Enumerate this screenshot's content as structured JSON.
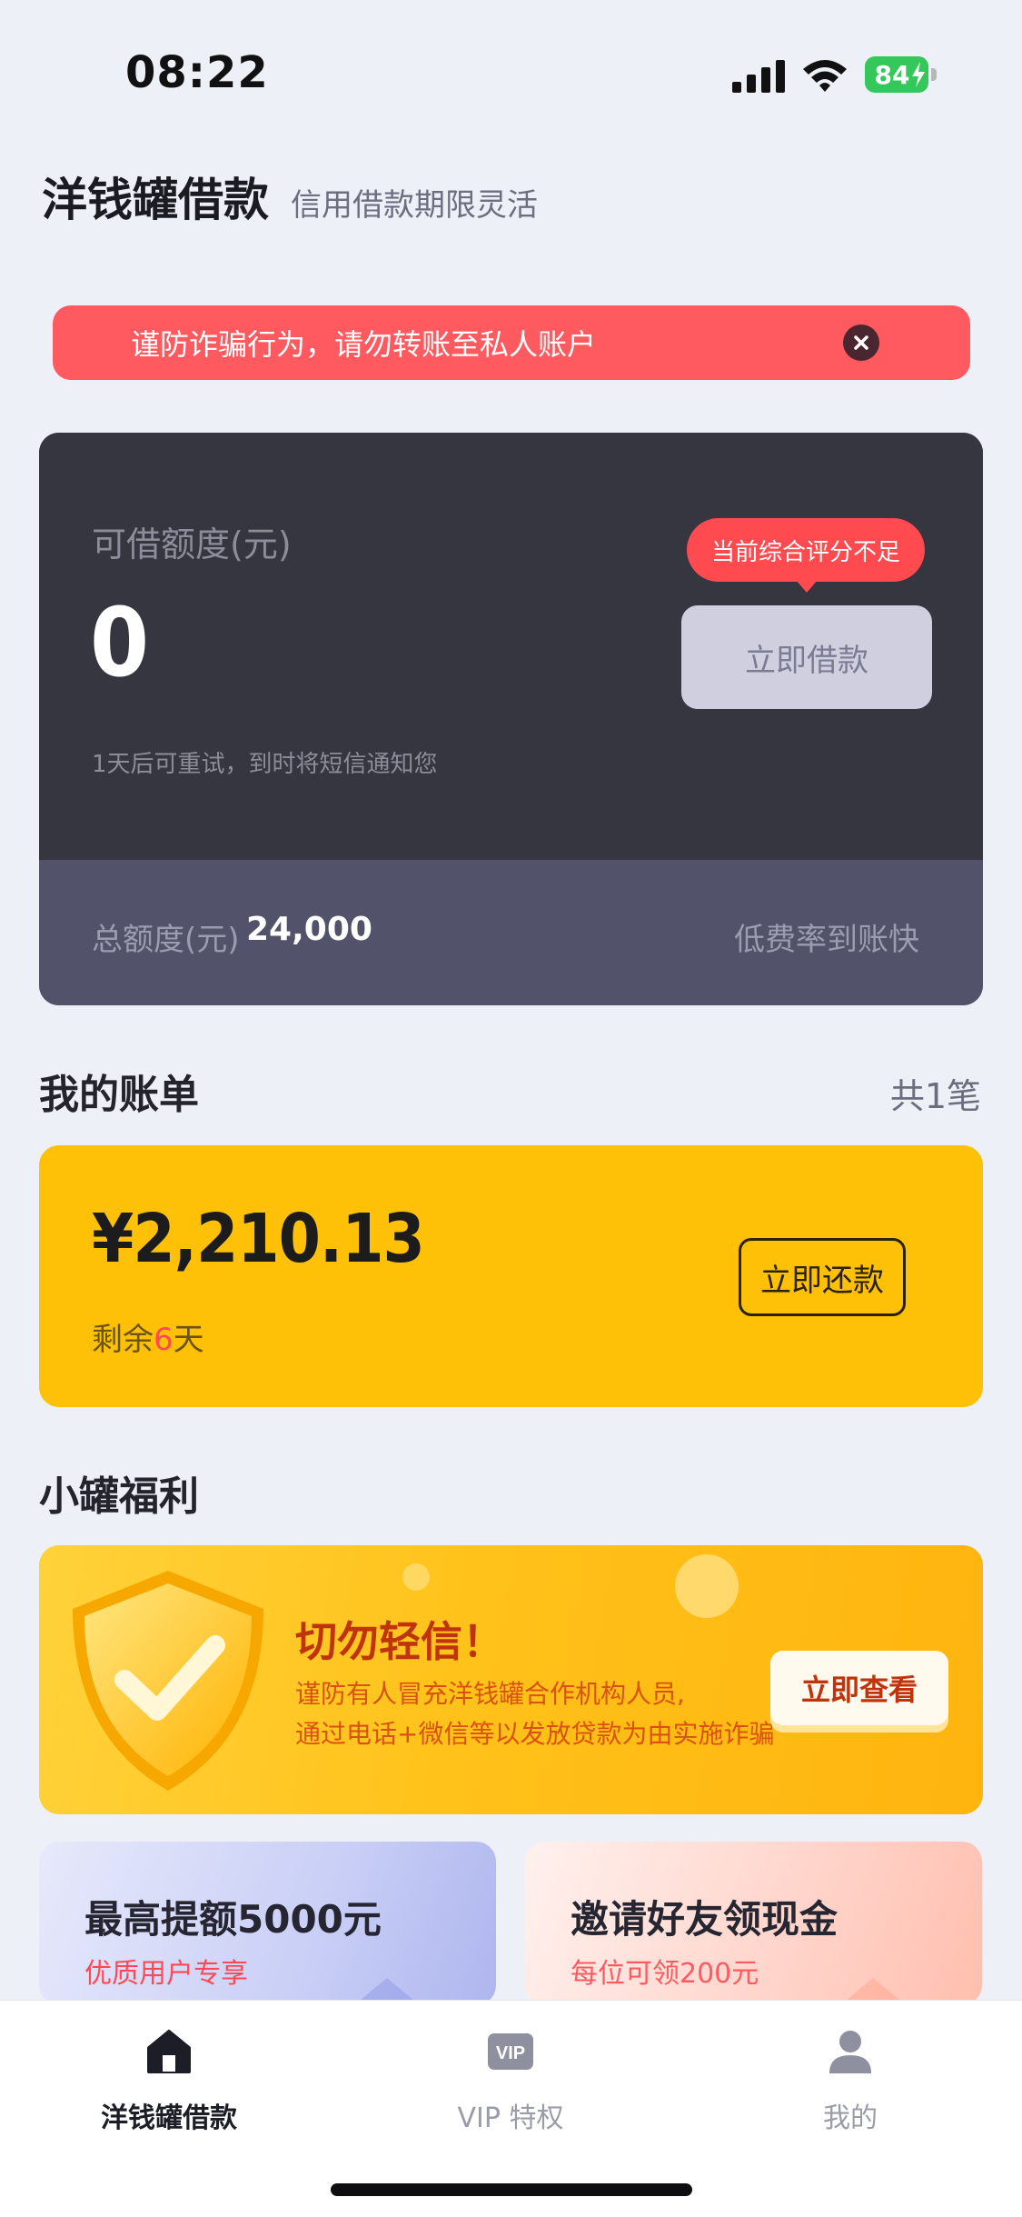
{
  "status_bar": {
    "time": "08:22",
    "battery": "84"
  },
  "header": {
    "title": "洋钱罐借款",
    "subtitle": "信用借款期限灵活"
  },
  "warning": {
    "text": "谨防诈骗行为，请勿转账至私人账户",
    "color": "#FF5A5F"
  },
  "credit": {
    "available_label": "可借额度(元)",
    "available_amount": "0",
    "retry_note": "1天后可重试，到时将短信通知您",
    "tooltip": "当前综合评分不足",
    "borrow_button": "立即借款",
    "total_label": "总额度(元)",
    "total_value": "24,000",
    "rate_text": "低费率到账快"
  },
  "bills": {
    "section_title": "我的账单",
    "count": "共1笔",
    "amount": "¥2,210.13",
    "remaining_prefix": "剩余",
    "remaining_days": "6",
    "remaining_suffix": "天",
    "repay_button": "立即还款",
    "card_color": "#FFC107"
  },
  "benefits": {
    "section_title": "小罐福利",
    "promo": {
      "title": "切勿轻信！",
      "line1": "谨防有人冒充洋钱罐合作机构人员,",
      "line2": "通过电话+微信等以发放贷款为由实施诈骗",
      "button": "立即查看",
      "icon": "shield-check-icon"
    },
    "cards": [
      {
        "title": "最高提额5000元",
        "subtitle": "优质用户专享"
      },
      {
        "title": "邀请好友领现金",
        "subtitle": "每位可领200元"
      }
    ]
  },
  "tabbar": {
    "tabs": [
      {
        "label": "洋钱罐借款",
        "icon": "home-icon",
        "active": true
      },
      {
        "label": "VIP 特权",
        "icon": "vip-icon",
        "active": false
      },
      {
        "label": "我的",
        "icon": "person-icon",
        "active": false
      }
    ]
  }
}
